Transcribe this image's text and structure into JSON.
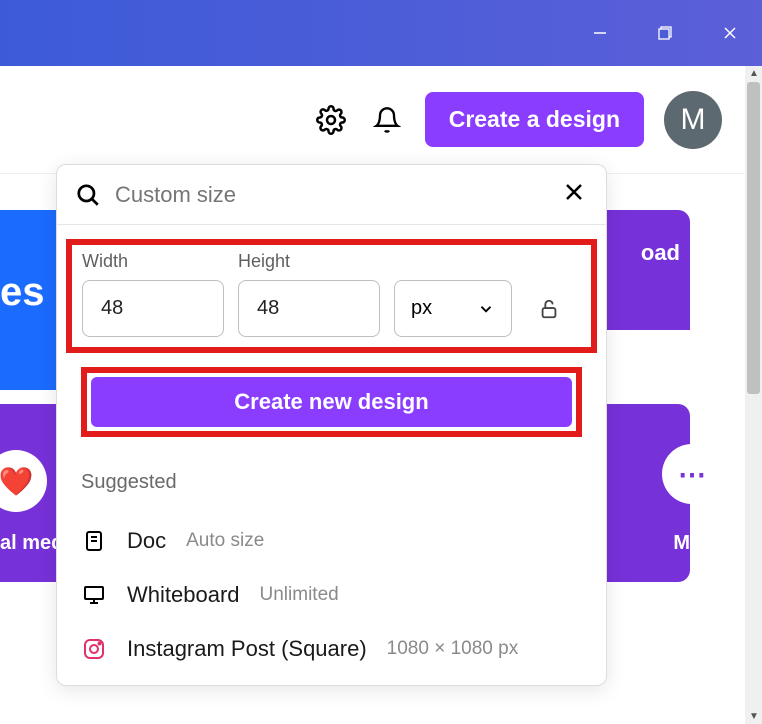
{
  "window": {
    "minimize": "—",
    "maximize": "",
    "close": ""
  },
  "topbar": {
    "create_label": "Create a design",
    "avatar_letter": "M"
  },
  "bg": {
    "es_text": "es",
    "upload_text": "oad",
    "media_text": "al medi",
    "m_text": "M"
  },
  "popover": {
    "search_placeholder": "Custom size",
    "width_label": "Width",
    "height_label": "Height",
    "width_value": "48",
    "height_value": "48",
    "unit": "px",
    "create_label": "Create new design",
    "suggested_title": "Suggested",
    "items": [
      {
        "name": "Doc",
        "meta": "Auto size"
      },
      {
        "name": "Whiteboard",
        "meta": "Unlimited"
      },
      {
        "name": "Instagram Post (Square)",
        "meta": "1080 × 1080 px"
      }
    ]
  }
}
